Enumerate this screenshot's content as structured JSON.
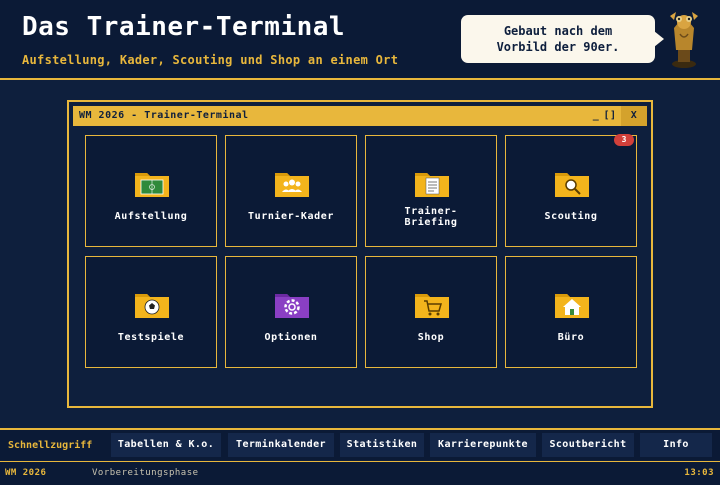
{
  "header": {
    "title": "Das Trainer-Terminal",
    "subtitle": "Aufstellung, Kader, Scouting und Shop an einem Ort",
    "bubble_text": "Gebaut nach dem\nVorbild der 90er.",
    "mascot_icon": "trophy-mascot-icon"
  },
  "window": {
    "title": "WM 2026 - Trainer-Terminal",
    "min_label": "_",
    "max_label": "[]",
    "close_label": "X",
    "tiles": [
      {
        "label": "Aufstellung",
        "icon": "tactics-folder-icon",
        "color": "#f3b41c"
      },
      {
        "label": "Turnier-Kader",
        "icon": "team-folder-icon",
        "color": "#f3b41c"
      },
      {
        "label": "Trainer-\nBriefing",
        "icon": "document-folder-icon",
        "color": "#f3b41c"
      },
      {
        "label": "Scouting",
        "icon": "search-folder-icon",
        "color": "#f3b41c",
        "badge": "3"
      },
      {
        "label": "Testspiele",
        "icon": "ball-folder-icon",
        "color": "#f3b41c"
      },
      {
        "label": "Optionen",
        "icon": "gear-folder-icon",
        "color": "#8a3fc4"
      },
      {
        "label": "Shop",
        "icon": "cart-folder-icon",
        "color": "#f3b41c"
      },
      {
        "label": "Büro",
        "icon": "home-folder-icon",
        "color": "#f3b41c"
      }
    ]
  },
  "quickbar": {
    "label": "Schnellzugriff",
    "buttons": [
      "Tabellen & K.o.",
      "Terminkalender",
      "Statistiken",
      "Karrierepunkte",
      "Scoutbericht",
      "Info"
    ]
  },
  "statusbar": {
    "tournament": "WM 2026",
    "phase": "Vorbereitungsphase",
    "time": "13:03"
  },
  "colors": {
    "background": "#0e1f3d",
    "accent": "#e8b73c",
    "badge": "#d2403a"
  }
}
